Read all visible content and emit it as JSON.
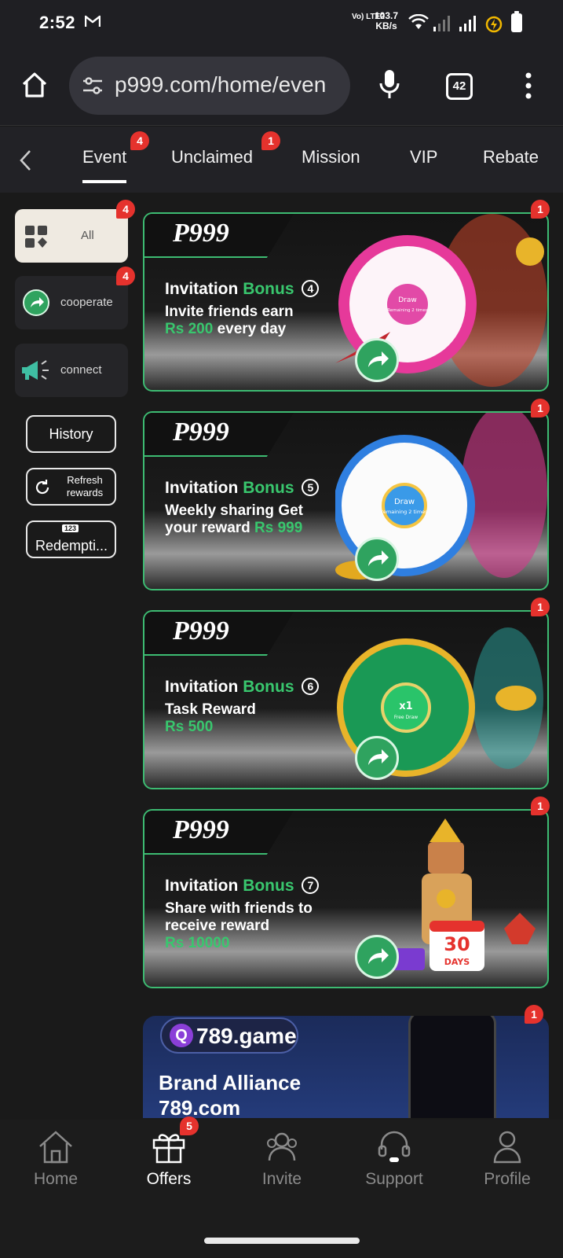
{
  "status_bar": {
    "time": "2:52",
    "network_label": "Vo) LTE2",
    "speed_value": "103.7",
    "speed_unit": "KB/s"
  },
  "browser": {
    "url": "p999.com/home/even",
    "tab_count": "42"
  },
  "top_tabs": [
    {
      "label": "Event",
      "badge": "4",
      "active": true
    },
    {
      "label": "Unclaimed",
      "badge": "1",
      "active": false
    },
    {
      "label": "Mission",
      "badge": "",
      "active": false
    },
    {
      "label": "VIP",
      "badge": "",
      "active": false
    },
    {
      "label": "Rebate",
      "badge": "",
      "active": false
    }
  ],
  "sidebar": {
    "categories": [
      {
        "label": "All",
        "badge": "4"
      },
      {
        "label": "cooperate",
        "badge": "4"
      },
      {
        "label": "connect",
        "badge": ""
      }
    ],
    "buttons": {
      "history": "History",
      "refresh_line1": "Refresh",
      "refresh_line2": "rewards",
      "redemption": "Redempti...",
      "redemption_icon_text": "123"
    }
  },
  "cards": [
    {
      "logo": "P999",
      "title_prefix": "Invitation",
      "title_highlight": "Bonus",
      "number": "4",
      "desc": "Invite friends earn",
      "amount": "Rs 200",
      "desc_suffix": "every day",
      "badge": "1",
      "wheel_center_1": "Draw",
      "wheel_center_2": "Remaining 2 times"
    },
    {
      "logo": "P999",
      "title_prefix": "Invitation",
      "title_highlight": "Bonus",
      "number": "5",
      "desc": "Weekly sharing Get your reward",
      "amount": "Rs 999",
      "desc_suffix": "",
      "badge": "1",
      "wheel_center_1": "Draw",
      "wheel_center_2": "remaining 2 times"
    },
    {
      "logo": "P999",
      "title_prefix": "Invitation",
      "title_highlight": "Bonus",
      "number": "6",
      "desc": "Task Reward",
      "amount": "Rs 500",
      "desc_suffix": "",
      "badge": "1",
      "wheel_center_1": "x1",
      "wheel_center_2": "Free Draw"
    },
    {
      "logo": "P999",
      "title_prefix": "Invitation",
      "title_highlight": "Bonus",
      "number": "7",
      "desc": "Share with friends to receive reward",
      "amount": "Rs 10000",
      "desc_suffix": "",
      "badge": "1",
      "calendar_num": "30",
      "calendar_word": "DAYS"
    }
  ],
  "brand_card": {
    "pill_letter": "Q",
    "pill_name": "789.game",
    "title": "Brand Alliance",
    "domain": "789.com",
    "badge": "1"
  },
  "bottom_nav": [
    {
      "label": "Home",
      "icon": "home-icon",
      "active": false,
      "badge": ""
    },
    {
      "label": "Offers",
      "icon": "gift-icon",
      "active": true,
      "badge": "5"
    },
    {
      "label": "Invite",
      "icon": "people-icon",
      "active": false,
      "badge": ""
    },
    {
      "label": "Support",
      "icon": "headset-icon",
      "active": false,
      "badge": ""
    },
    {
      "label": "Profile",
      "icon": "person-icon",
      "active": false,
      "badge": ""
    }
  ],
  "colors": {
    "accent_green": "#39c76e",
    "badge_red": "#e5322d",
    "card_border": "#3dbb72"
  }
}
